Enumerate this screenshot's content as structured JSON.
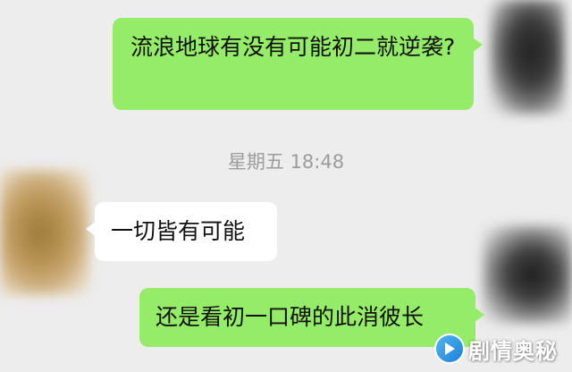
{
  "messages": [
    {
      "id": "m1",
      "side": "right",
      "text": "流浪地球有没有可能初二就逆袭?"
    },
    {
      "id": "m2",
      "side": "left",
      "text": "一切皆有可能"
    },
    {
      "id": "m3",
      "side": "right",
      "text": "还是看初一口碑的此消彼长"
    }
  ],
  "timestamp": "星期五 18:48",
  "watermark": {
    "text": "剧情奥秘",
    "icon": "play-icon"
  },
  "colors": {
    "background": "#ededed",
    "outgoing_bubble": "#95ec69",
    "incoming_bubble": "#ffffff",
    "timestamp_text": "#9c9c9c"
  }
}
